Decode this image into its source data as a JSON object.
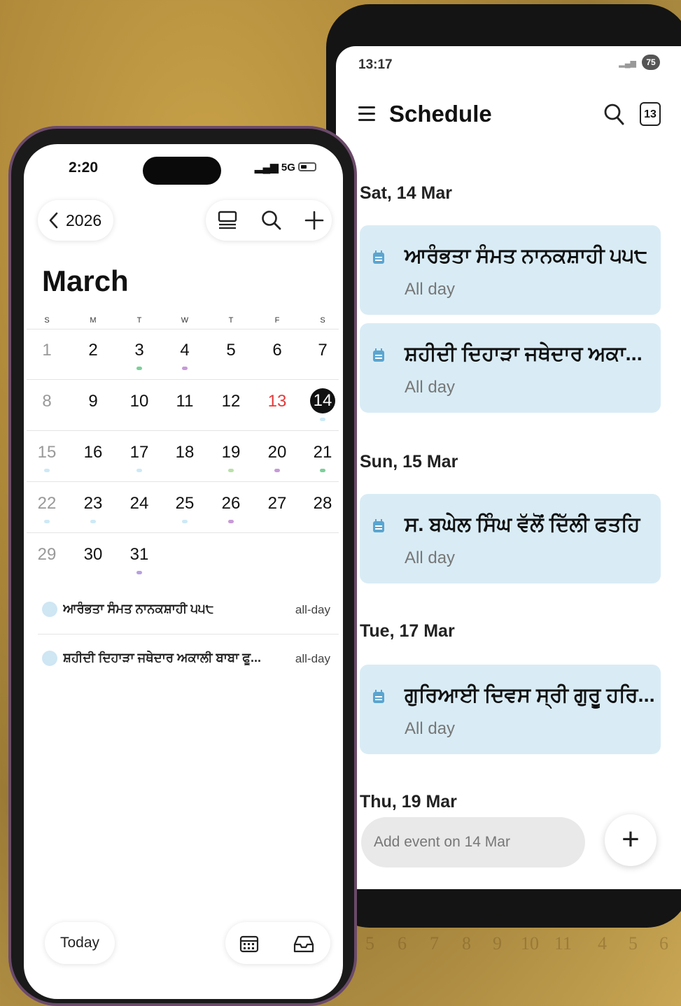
{
  "background_grid": [
    "5",
    "6",
    "7",
    "8",
    "9",
    "10",
    "11",
    "4",
    "5",
    "6"
  ],
  "android": {
    "status": {
      "time": "13:17",
      "battery": "75"
    },
    "header": {
      "title": "Schedule",
      "date_button": "13"
    },
    "sections": [
      {
        "day": "Sat, 14 Mar",
        "events": [
          {
            "title": "ਆਰੰਭਤਾ ਸੰਮਤ ਨਾਨਕਸ਼ਾਹੀ ੫੫੮",
            "time": "All day"
          },
          {
            "title": "ਸ਼ਹੀਦੀ ਦਿਹਾੜਾ ਜਥੇਦਾਰ ਅਕਾ...",
            "time": "All day"
          }
        ]
      },
      {
        "day": "Sun, 15 Mar",
        "events": [
          {
            "title": "ਸ. ਬਘੇਲ ਸਿੰਘ ਵੱਲੋਂ ਦਿੱਲੀ ਫਤਹਿ",
            "time": "All day"
          }
        ]
      },
      {
        "day": "Tue, 17 Mar",
        "events": [
          {
            "title": "ਗੁਰਿਆਈ ਦਿਵਸ ਸ੍ਰੀ ਗੁਰੂ ਹਰਿ...",
            "time": "All day"
          }
        ]
      },
      {
        "day": "Thu, 19 Mar",
        "events": []
      }
    ],
    "add_event_placeholder": "Add event on 14 Mar",
    "fab_icon": "plus-icon",
    "event_icon_color": "#5aa5d0",
    "card_color": "#d9ecf5"
  },
  "iphone": {
    "status": {
      "time": "2:20",
      "network": "5G"
    },
    "nav": {
      "back_label": "2026",
      "tools": [
        "list-view-icon",
        "search-icon",
        "plus-icon"
      ]
    },
    "month": "March",
    "weekdays": [
      "S",
      "M",
      "T",
      "W",
      "T",
      "F",
      "S"
    ],
    "weeks": [
      [
        {
          "d": "1",
          "dim": true
        },
        {
          "d": "2"
        },
        {
          "d": "3",
          "dot": "#7ccf9a"
        },
        {
          "d": "4",
          "dot": "#c69ad8"
        },
        {
          "d": "5"
        },
        {
          "d": "6"
        },
        {
          "d": "7"
        }
      ],
      [
        {
          "d": "8",
          "dim": true
        },
        {
          "d": "9"
        },
        {
          "d": "10"
        },
        {
          "d": "11"
        },
        {
          "d": "12"
        },
        {
          "d": "13",
          "red": true
        },
        {
          "d": "14",
          "sel": true,
          "dot": "#cde9f6"
        }
      ],
      [
        {
          "d": "15",
          "dim": true,
          "dot": "#cde9f6"
        },
        {
          "d": "16"
        },
        {
          "d": "17",
          "dot": "#cde9f6"
        },
        {
          "d": "18"
        },
        {
          "d": "19",
          "dot": "#b9e0a8"
        },
        {
          "d": "20",
          "dot": "#c69ad8"
        },
        {
          "d": "21",
          "dot": "#7ccf9a"
        }
      ],
      [
        {
          "d": "22",
          "dim": true,
          "dot": "#cde9f6"
        },
        {
          "d": "23",
          "dot": "#cde9f6"
        },
        {
          "d": "24"
        },
        {
          "d": "25",
          "dot": "#cde9f6"
        },
        {
          "d": "26",
          "dot": "#c69ad8"
        },
        {
          "d": "27"
        },
        {
          "d": "28"
        }
      ],
      [
        {
          "d": "29",
          "dim": true
        },
        {
          "d": "30"
        },
        {
          "d": "31",
          "dot": "#b8a0e0"
        }
      ]
    ],
    "day_events": [
      {
        "title": "ਆਰੰਭਤਾ ਸੰਮਤ ਨਾਨਕਸ਼ਾਹੀ ੫੫੮",
        "time": "all-day"
      },
      {
        "title": "ਸ਼ਹੀਦੀ ਦਿਹਾੜਾ ਜਥੇਦਾਰ ਅਕਾਲੀ ਬਾਬਾ ਫੂ...",
        "time": "all-day"
      }
    ],
    "bottom": {
      "today_label": "Today",
      "tools": [
        "calendar-grid-icon",
        "inbox-icon"
      ]
    }
  }
}
